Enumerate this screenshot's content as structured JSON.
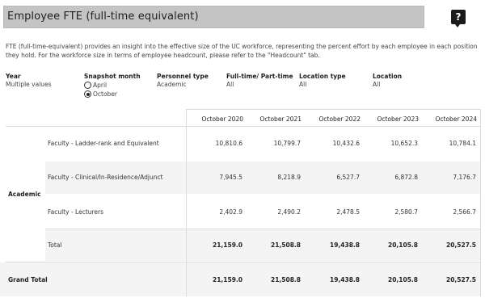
{
  "header": {
    "title": "Employee FTE (full-time equivalent)",
    "help_icon": "?"
  },
  "description": "FTE (full-time-equivalent) provides an insight into the effective size of the UC workforce, representing the percent effort by each employee in each position they hold. For the workforce size in terms of employee headcount, please refer to the \"Headcount\" tab.",
  "filters": {
    "year": {
      "label": "Year",
      "value": "Multiple values"
    },
    "snapshot": {
      "label": "Snapshot month",
      "options": [
        "April",
        "October"
      ],
      "selected": "October"
    },
    "personnel": {
      "label": "Personnel type",
      "value": "Academic"
    },
    "fulltime": {
      "label": "Full-time/ Part-time",
      "value": "All"
    },
    "location_type": {
      "label": "Location type",
      "value": "All"
    },
    "location": {
      "label": "Location",
      "value": "All"
    }
  },
  "table": {
    "columns": [
      "October 2020",
      "October 2021",
      "October 2022",
      "October 2023",
      "October 2024"
    ],
    "group_label": "Academic",
    "rows": [
      {
        "label": "Faculty - Ladder-rank and Equivalent",
        "values": [
          "10,810.6",
          "10,799.7",
          "10,432.6",
          "10,652.3",
          "10,784.1"
        ]
      },
      {
        "label": "Faculty - Clinical/In-Residence/Adjunct",
        "values": [
          "7,945.5",
          "8,218.9",
          "6,527.7",
          "6,872.8",
          "7,176.7"
        ]
      },
      {
        "label": "Faculty - Lecturers",
        "values": [
          "2,402.9",
          "2,490.2",
          "2,478.5",
          "2,580.7",
          "2,566.7"
        ]
      },
      {
        "label": "Total",
        "values": [
          "21,159.0",
          "21,508.8",
          "19,438.8",
          "20,105.8",
          "20,527.5"
        ]
      }
    ],
    "grand_total": {
      "label": "Grand Total",
      "values": [
        "21,159.0",
        "21,508.8",
        "19,438.8",
        "20,105.8",
        "20,527.5"
      ]
    }
  }
}
